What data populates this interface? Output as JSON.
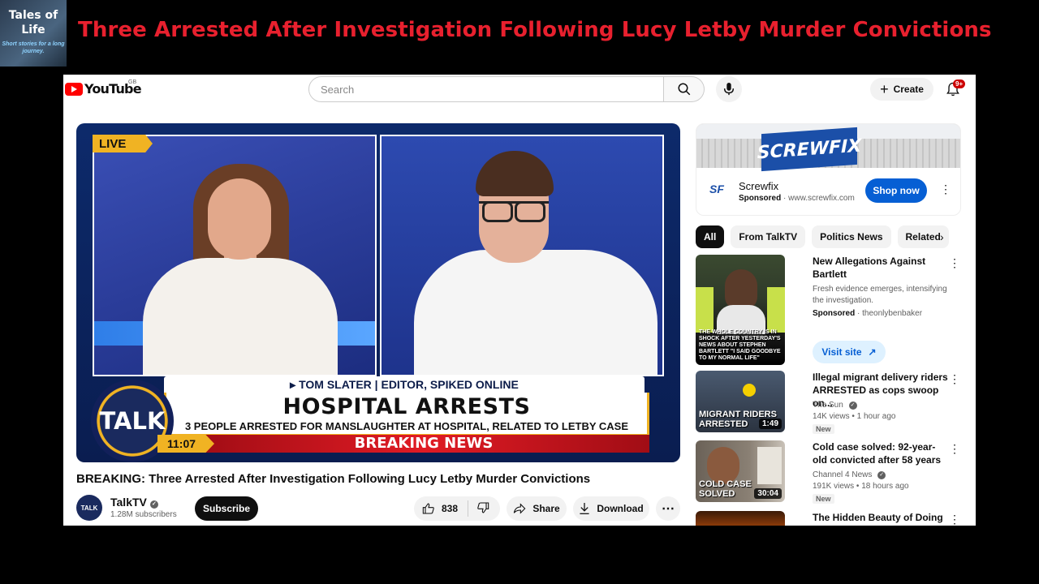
{
  "overlay": {
    "channel_logo_line1": "Tales of",
    "channel_logo_line2": "Life",
    "channel_logo_tagline": "Short stories for a long journey.",
    "title": "Three Arrested After Investigation Following Lucy Letby Murder Convictions"
  },
  "topbar": {
    "logo_text": "YouTube",
    "region": "GB",
    "search_placeholder": "Search",
    "create_label": "Create",
    "notifications_count": "9+"
  },
  "player": {
    "live_label": "LIVE",
    "lower_third_name": "▸ TOM SLATER | EDITOR, SPIKED ONLINE",
    "headline": "HOSPITAL ARRESTS",
    "subheadline": "3 PEOPLE ARRESTED FOR MANSLAUGHTER AT HOSPITAL, RELATED TO LETBY CASE",
    "time": "11:07",
    "breaking": "BREAKING NEWS",
    "brand": "TALK"
  },
  "video": {
    "title": "BREAKING: Three Arrested After Investigation Following Lucy Letby Murder Convictions",
    "channel_name": "TalkTV",
    "channel_avatar_text": "TALK",
    "subscribers": "1.28M subscribers",
    "subscribe_label": "Subscribe",
    "likes": "838",
    "share_label": "Share",
    "download_label": "Download"
  },
  "ad": {
    "sign_text": "SCREWFIX",
    "name": "Screwfix",
    "sponsored_label": "Sponsored",
    "domain": "www.screwfix.com",
    "cta": "Shop now"
  },
  "chips": [
    "All",
    "From TalkTV",
    "Politics News",
    "Related"
  ],
  "recommendations": [
    {
      "title": "New Allegations Against Bartlett",
      "description": "Fresh evidence emerges, intensifying the investigation.",
      "sponsored_label": "Sponsored",
      "channel": "theonlybenbaker",
      "thumb_caption": "THE WHOLE COUNTRY IS IN SHOCK AFTER YESTERDAY'S NEWS ABOUT STEPHEN BARTLETT \"I SAID GOODBYE TO MY NORMAL LIFE\"",
      "cta": "Visit site"
    },
    {
      "title": "Illegal migrant delivery riders ARRESTED as cops swoop on...",
      "channel": "The Sun",
      "views": "14K views",
      "age": "1 hour ago",
      "badge": "New",
      "duration": "1:49",
      "thumb_caption": "MIGRANT RIDERS ARRESTED"
    },
    {
      "title": "Cold case solved: 92-year-old convicted after 58 years",
      "channel": "Channel 4 News",
      "views": "191K views",
      "age": "18 hours ago",
      "badge": "New",
      "duration": "30:04",
      "thumb_caption": "COLD CASE SOLVED"
    },
    {
      "title": "The Hidden Beauty of Doing"
    }
  ],
  "colors": {
    "overlay_title": "#e8202e",
    "youtube_red": "#ff0000",
    "accent_blue": "#065fd4",
    "talk_gold": "#f0b323"
  }
}
